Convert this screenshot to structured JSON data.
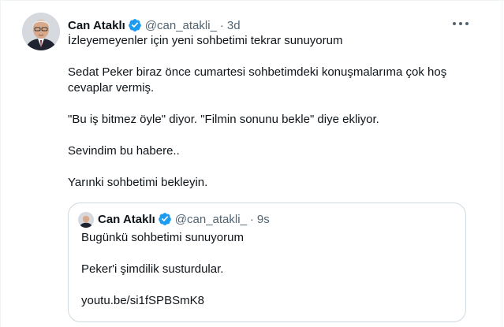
{
  "tweet": {
    "author_name": "Can Ataklı",
    "handle": "@can_atakli_",
    "separator": "·",
    "time": "3d",
    "lines": [
      "İzleyemeyenler için yeni sohbetimi tekrar sunuyorum",
      "Sedat Peker biraz önce cumartesi sohbetimdeki konuşmalarıma çok hoş cevaplar vermiş.",
      "\"Bu iş bitmez öyle\" diyor. \"Filmin sonunu bekle\" diye ekliyor.",
      "Sevindim bu habere..",
      "Yarınki sohbetimi bekleyin."
    ]
  },
  "quoted": {
    "author_name": "Can Ataklı",
    "handle": "@can_atakli_",
    "separator": "·",
    "time": "9s",
    "lines": [
      "Bugünkü sohbetimi sunuyorum",
      "Peker'i şimdilik susturdular.",
      "youtu.be/si1fSPBSmK8"
    ]
  },
  "colors": {
    "text": "#0f1419",
    "secondary": "#536471",
    "verified": "#1d9bf0",
    "border": "#cfd9de"
  },
  "icons": [
    "verified-badge-icon",
    "more-options-icon"
  ]
}
